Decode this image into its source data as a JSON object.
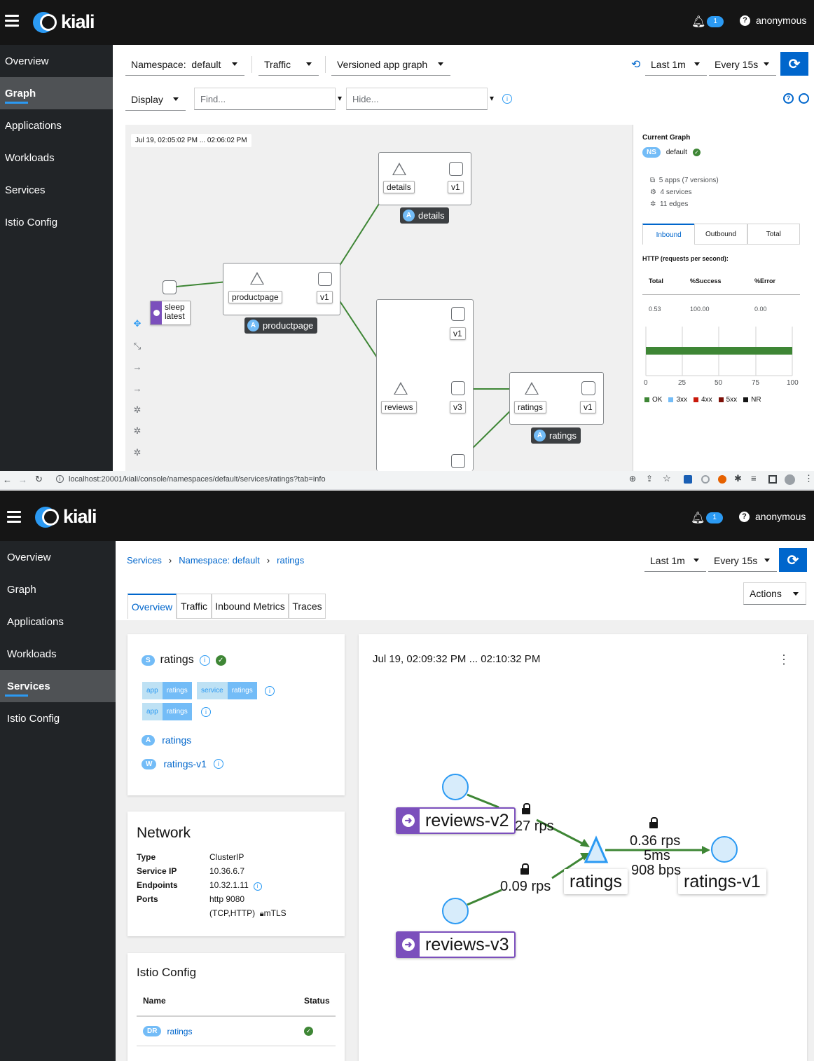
{
  "top": {
    "masthead": {
      "logo": "kiali",
      "notification_count": "1",
      "user": "anonymous"
    },
    "nav": [
      "Overview",
      "Graph",
      "Applications",
      "Workloads",
      "Services",
      "Istio Config"
    ],
    "toolbar": {
      "namespace_label": "Namespace:",
      "namespace_value": "default",
      "traffic": "Traffic",
      "graph_type": "Versioned app graph",
      "duration": "Last 1m",
      "refresh": "Every 15s",
      "display": "Display",
      "find_placeholder": "Find...",
      "hide_placeholder": "Hide..."
    },
    "graph": {
      "time_range": "Jul 19, 02:05:02 PM ... 02:06:02 PM",
      "nodes": {
        "sleep": "sleep",
        "sleep_version": "latest",
        "productpage": "productpage",
        "details": "details",
        "reviews": "reviews",
        "ratings": "ratings",
        "v1": "v1",
        "v3": "v3"
      },
      "app_tags": {
        "details": "details",
        "productpage": "productpage",
        "ratings": "ratings"
      },
      "badge_app": "A"
    },
    "summary": {
      "title": "Current Graph",
      "ns_badge": "NS",
      "namespace": "default",
      "apps": "5 apps (7 versions)",
      "services": "4 services",
      "edges": "11 edges",
      "tabs": [
        "Inbound",
        "Outbound",
        "Total"
      ],
      "http_title": "HTTP (requests per second):",
      "headers": [
        "Total",
        "%Success",
        "%Error"
      ],
      "values": [
        "0.53",
        "100.00",
        "0.00"
      ],
      "success_fraction": 1.0,
      "ticks": [
        "0",
        "25",
        "50",
        "75",
        "100"
      ],
      "legend": [
        {
          "label": "OK",
          "color": "#3e8635"
        },
        {
          "label": "3xx",
          "color": "#73bcf7"
        },
        {
          "label": "4xx",
          "color": "#c9190b"
        },
        {
          "label": "5xx",
          "color": "#7d1007"
        },
        {
          "label": "NR",
          "color": "#151515"
        }
      ]
    }
  },
  "browser": {
    "url": "localhost:20001/kiali/console/namespaces/default/services/ratings?tab=info"
  },
  "bottom": {
    "masthead": {
      "logo": "kiali",
      "notification_count": "1",
      "user": "anonymous"
    },
    "nav": [
      "Overview",
      "Graph",
      "Applications",
      "Workloads",
      "Services",
      "Istio Config"
    ],
    "breadcrumb": [
      "Services",
      "Namespace: default",
      "ratings"
    ],
    "duration": "Last 1m",
    "refresh": "Every 15s",
    "actions": "Actions",
    "tabs": [
      "Overview",
      "Traffic",
      "Inbound Metrics",
      "Traces"
    ],
    "service": {
      "badge": "S",
      "name": "ratings",
      "labels": [
        {
          "key": "app",
          "value": "ratings"
        },
        {
          "key": "service",
          "value": "ratings"
        },
        {
          "key": "app",
          "value": "ratings"
        }
      ],
      "app_badge": "A",
      "app": "ratings",
      "workload_badge": "W",
      "workload": "ratings-v1"
    },
    "network": {
      "title": "Network",
      "rows": [
        {
          "k": "Type",
          "v": "ClusterIP"
        },
        {
          "k": "Service IP",
          "v": "10.36.6.7"
        },
        {
          "k": "Endpoints",
          "v": "10.32.1.11"
        },
        {
          "k": "Ports",
          "v": "http 9080"
        }
      ],
      "ports_extra": "(TCP,HTTP)",
      "mtls": "mTLS"
    },
    "istio": {
      "title": "Istio Config",
      "headers": [
        "Name",
        "Status"
      ],
      "badge": "DR",
      "name": "ratings"
    },
    "minigraph": {
      "time_range": "Jul 19, 02:09:32 PM ... 02:10:32 PM",
      "reviews_v2": "reviews-v2",
      "reviews_v3": "reviews-v3",
      "ratings": "ratings",
      "ratings_v1": "ratings-v1",
      "edge_v2": "27 rps",
      "edge_v3": "0.09 rps",
      "edge_out_rps": "0.36 rps",
      "edge_out_ms": "5ms",
      "edge_out_bps": "908 bps"
    }
  }
}
